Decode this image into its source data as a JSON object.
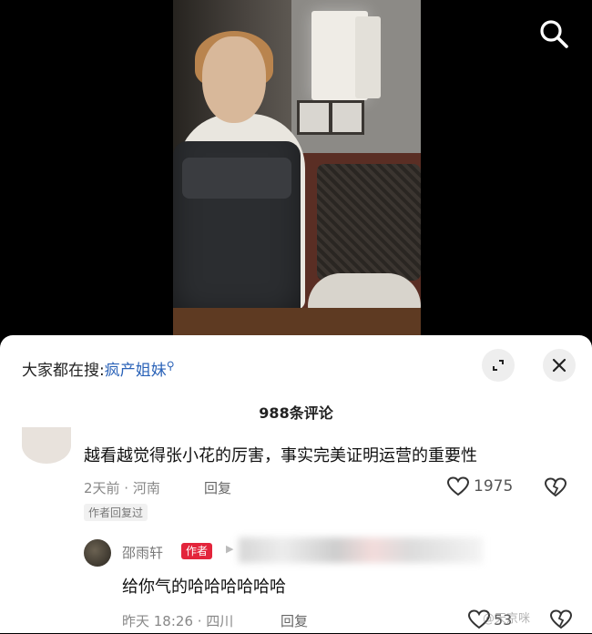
{
  "video": {
    "caption_fragment": "…",
    "search_icon": "search-icon"
  },
  "panel": {
    "trending_prefix": "大家都在搜:",
    "trending_link": "疯产姐妹",
    "expand_icon": "expand-icon",
    "close_icon": "close-icon",
    "comment_count": "988条评论"
  },
  "comment": {
    "text": "越看越觉得张小花的厉害，事实完美证明运营的重要性",
    "time_location": "2天前 · 河南",
    "reply_label": "回复",
    "like_count": "1975",
    "author_replied_badge": "作者回复过"
  },
  "reply": {
    "name": "邵雨轩",
    "tag": "作者",
    "text": "给你气的哈哈哈哈哈哈",
    "time_location": "昨天 18:26 · 四川",
    "reply_label": "回复",
    "like_count": "53"
  },
  "watermark": "@天京咪",
  "colors": {
    "link": "#2b63b8",
    "author_tag": "#e3243b"
  }
}
